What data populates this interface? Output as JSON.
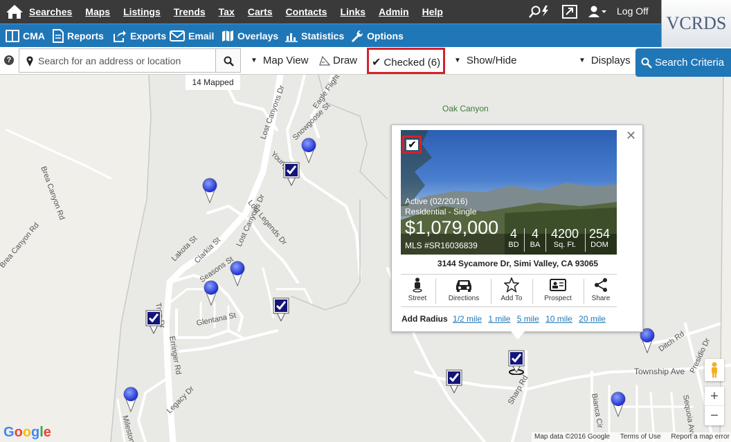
{
  "topnav": {
    "items": [
      "Searches",
      "Maps",
      "Listings",
      "Trends",
      "Tax",
      "Carts",
      "Contacts",
      "Links",
      "Admin",
      "Help"
    ],
    "logoff": "Log Off",
    "logo": "VCRDS"
  },
  "subnav": {
    "cma": "CMA",
    "reports": "Reports",
    "exports": "Exports",
    "email": "Email",
    "overlays": "Overlays",
    "statistics": "Statistics",
    "options": "Options"
  },
  "toolbar": {
    "help": "?",
    "search_placeholder": "Search for an address or location",
    "map_view": "Map View",
    "draw": "Draw",
    "checked": "Checked (6)",
    "show_hide": "Show/Hide",
    "displays": "Displays",
    "search_criteria": "Search Criteria"
  },
  "map": {
    "mapped": "14 Mapped",
    "labels": {
      "oak_canyon": "Oak Canyon",
      "brea_canyon_rd": "Brea Canyon Rd",
      "brea_canyon_rd_2": "Brea Canyon Rd",
      "lost_canyons_dr": "Lost Canyons Dr",
      "lost_canyons_dr_2": "Lost Canyons Dr",
      "eagle_flight": "Eagle Flight Dr",
      "snowgoose": "Snowgoose St",
      "lost_legends": "Lost Legends Dr",
      "lakota": "Lakota St",
      "clarkia": "Clarkia St",
      "seasons": "Seasons St",
      "glentana": "Glentana St",
      "erringer": "Erringer Rd",
      "legacy": "Legacy Dr",
      "sharp": "Sharp Rd",
      "township": "Township Ave",
      "ditch": "Ditch Rd",
      "presidio": "Presidio Dr",
      "bianca": "Bianca Cir",
      "sequoia": "Sequoia Ave",
      "young": "Young Dr",
      "trea": "Trea Dr",
      "milestone": "Milestone"
    },
    "attribution_data": "Map data ©2016 Google",
    "attribution_terms": "Terms of Use",
    "attribution_report": "Report a map error",
    "zoom_in": "+",
    "zoom_out": "−"
  },
  "popup": {
    "status": "Active (02/20/16)",
    "type": "Residential - Single",
    "price": "$1,079,000",
    "mls": "MLS #SR16036839",
    "beds": "4",
    "beds_label": "BD",
    "baths": "4",
    "baths_label": "BA",
    "sqft": "4200",
    "sqft_label": "Sq. Ft.",
    "dom": "254",
    "dom_label": "DOM",
    "address": "3144 Sycamore Dr, Simi Valley, CA 93065",
    "actions": [
      "Street",
      "Directions",
      "Add To",
      "Prospect",
      "Share"
    ],
    "radius_label": "Add Radius",
    "radius_options": [
      "1/2 mile",
      "1 mile",
      "5 mile",
      "10 mile",
      "20 mile"
    ]
  },
  "colors": {
    "topnav_bg": "#3a3a3a",
    "subnav_bg": "#1f77b7",
    "highlight": "#d3232a",
    "pin_blue": "#3d4fe0",
    "check_navy": "#14157a"
  }
}
